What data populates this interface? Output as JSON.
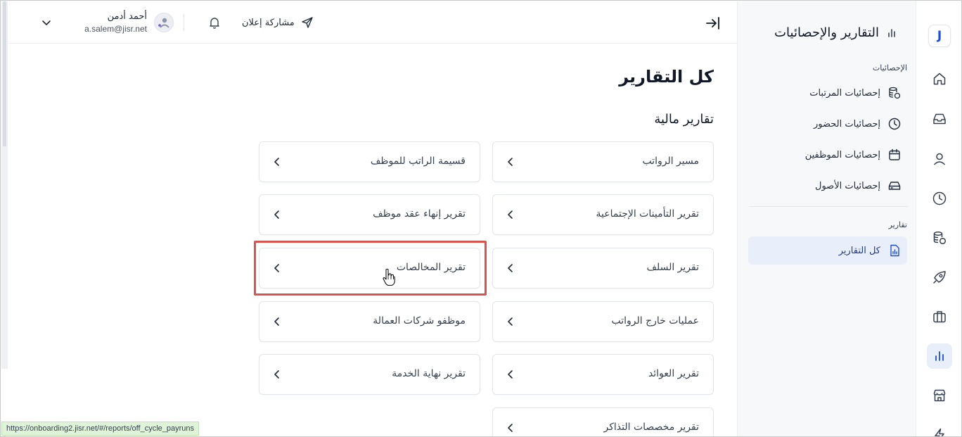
{
  "topbar": {
    "user_name": "أحمد أدمن",
    "user_email": "a.salem@jisr.net",
    "share_label": "مشاركة إعلان"
  },
  "main": {
    "page_title": "كل التقارير",
    "section_title": "تقارير مالية",
    "cards": [
      {
        "label": "مسير الرواتب"
      },
      {
        "label": "قسيمة الراتب للموظف"
      },
      {
        "label": "تقرير التأمينات الإجتماعية"
      },
      {
        "label": "تقرير إنهاء عقد موظف"
      },
      {
        "label": "تقرير السلف"
      },
      {
        "label": "تقرير المخالصات"
      },
      {
        "label": "عمليات خارج الرواتب"
      },
      {
        "label": "موظفو شركات العمالة"
      },
      {
        "label": "تقرير العوائد"
      },
      {
        "label": "تقرير نهاية الخدمة"
      },
      {
        "label": "تقرير مخصصات التذاكر"
      }
    ]
  },
  "sidebar": {
    "title": "التقارير والإحصائيات",
    "group_stats": "الإحصائيات",
    "stats_items": [
      {
        "label": "إحصائيات المرتبات",
        "icon": "coins-icon"
      },
      {
        "label": "إحصائيات الحضور",
        "icon": "clock-icon"
      },
      {
        "label": "إحصائيات الموظفين",
        "icon": "calendar-icon"
      },
      {
        "label": "إحصائيات الأصول",
        "icon": "drive-icon"
      }
    ],
    "group_reports": "تقارير",
    "reports_items": [
      {
        "label": "كل التقارير",
        "icon": "report-file-icon",
        "active": true
      }
    ]
  },
  "rail": {
    "logo_letter": "J",
    "icons": [
      "home-icon",
      "inbox-icon",
      "user-icon",
      "clock-icon",
      "coins-icon",
      "rocket-icon",
      "briefcase-icon",
      "bar-chart-icon",
      "store-icon",
      "bolt-icon"
    ],
    "active_icon": "bar-chart-icon"
  },
  "status_bar": {
    "url": "https://onboarding2.jisr.net/#/reports/off_cycle_payruns"
  },
  "colors": {
    "accent": "#1d4ed8",
    "active_bg": "#e8effb",
    "highlight_border": "#d9534f"
  }
}
